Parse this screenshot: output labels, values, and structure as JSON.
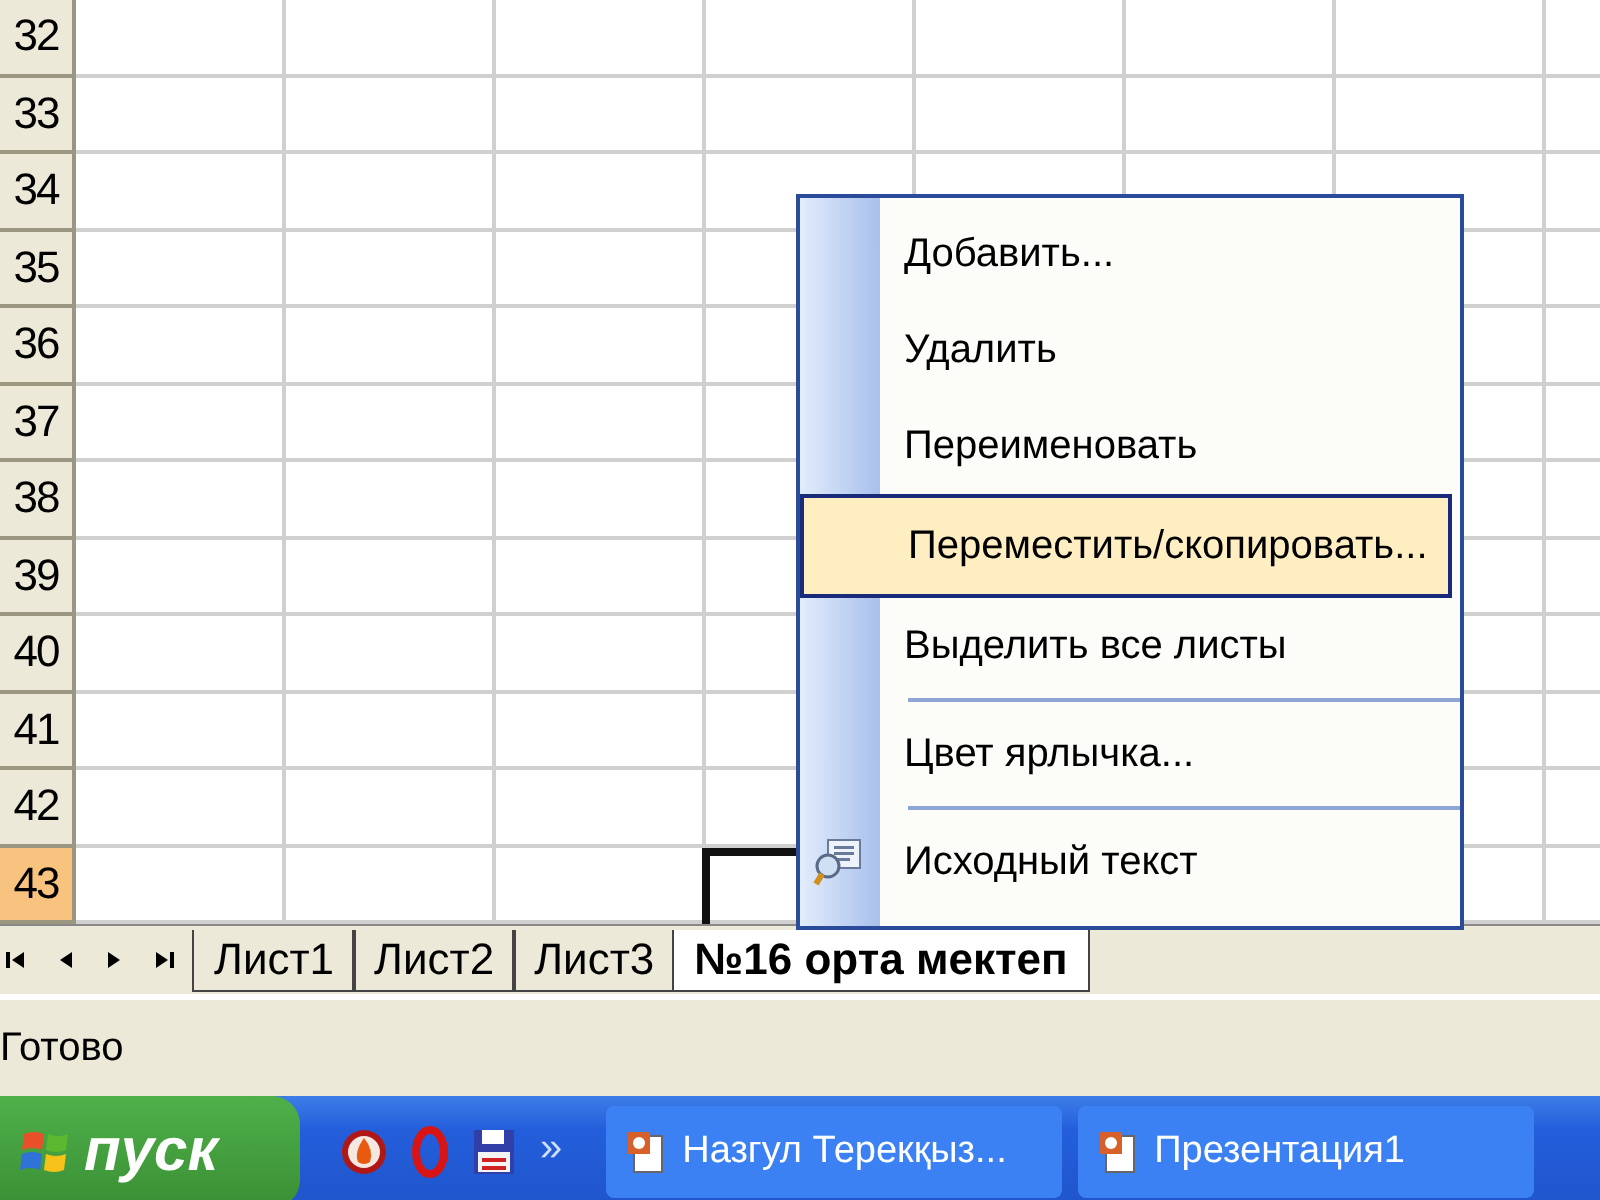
{
  "sheet": {
    "rows": [
      {
        "label": "32",
        "selected": false
      },
      {
        "label": "33",
        "selected": false
      },
      {
        "label": "34",
        "selected": false
      },
      {
        "label": "35",
        "selected": false
      },
      {
        "label": "36",
        "selected": false
      },
      {
        "label": "37",
        "selected": false
      },
      {
        "label": "38",
        "selected": false
      },
      {
        "label": "39",
        "selected": false
      },
      {
        "label": "40",
        "selected": false
      },
      {
        "label": "41",
        "selected": false
      },
      {
        "label": "42",
        "selected": false
      },
      {
        "label": "43",
        "selected": true
      }
    ]
  },
  "sheet_tabs": [
    {
      "label": "Лист1",
      "selected": false
    },
    {
      "label": "Лист2",
      "selected": false
    },
    {
      "label": "Лист3",
      "selected": false
    },
    {
      "label": "№16 орта мектеп",
      "selected": true
    }
  ],
  "context_menu": {
    "items": [
      {
        "label": "Добавить...",
        "selected": false,
        "separator_before": false,
        "has_icon": false
      },
      {
        "label": "Удалить",
        "selected": false,
        "separator_before": false,
        "has_icon": false
      },
      {
        "label": "Переименовать",
        "selected": false,
        "separator_before": false,
        "has_icon": false
      },
      {
        "label": "Переместить/скопировать...",
        "selected": true,
        "separator_before": false,
        "has_icon": false
      },
      {
        "label": "Выделить все листы",
        "selected": false,
        "separator_before": false,
        "has_icon": false
      },
      {
        "label": "Цвет ярлычка...",
        "selected": false,
        "separator_before": true,
        "has_icon": false
      },
      {
        "label": "Исходный текст",
        "selected": false,
        "separator_before": true,
        "has_icon": true
      }
    ]
  },
  "status_bar": {
    "text": "Готово"
  },
  "taskbar": {
    "start": "пуск",
    "overflow": "»",
    "tasks": [
      {
        "label": "Назгул Терекқыз..."
      },
      {
        "label": "Презентация1"
      }
    ]
  }
}
